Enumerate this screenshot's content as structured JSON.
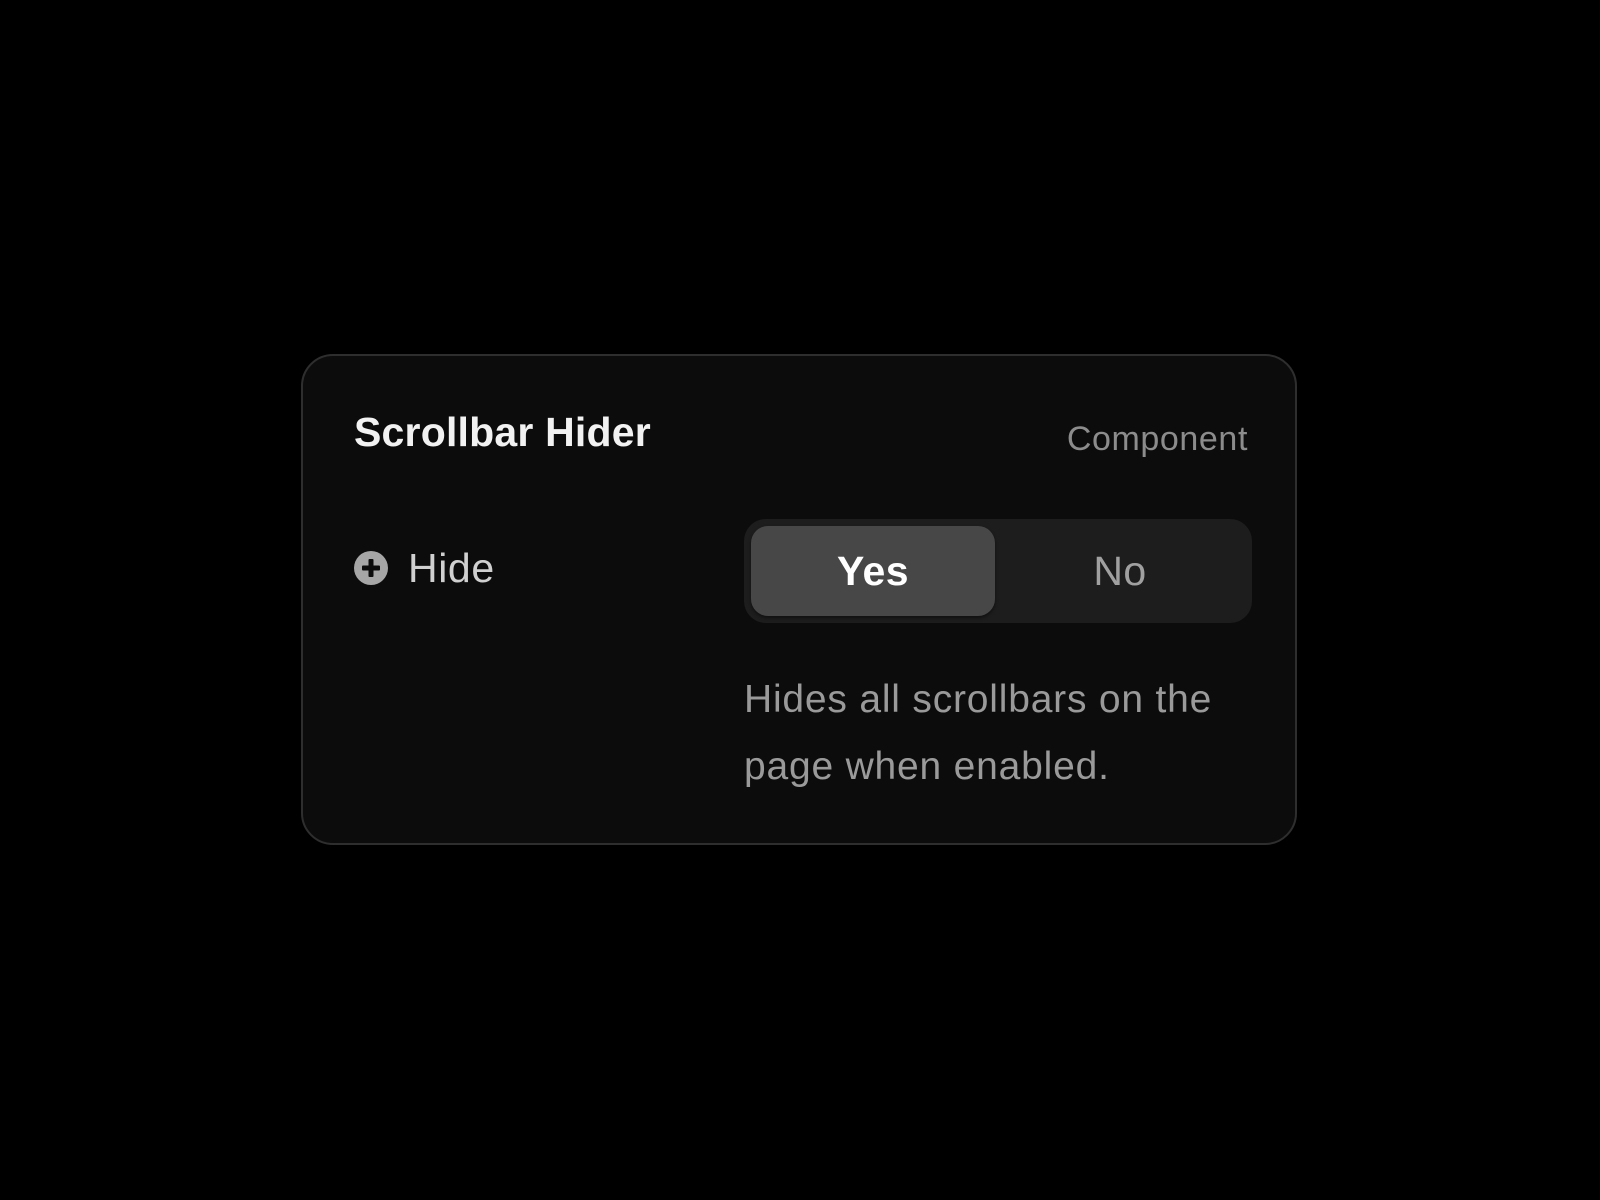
{
  "panel": {
    "title": "Scrollbar Hider",
    "type_label": "Component"
  },
  "property": {
    "icon": "plus-circle-icon",
    "label": "Hide",
    "options": [
      {
        "label": "Yes",
        "selected": true
      },
      {
        "label": "No",
        "selected": false
      }
    ],
    "description": "Hides all scrollbars on the page when enabled."
  },
  "colors": {
    "background": "#000000",
    "panel": "#0c0c0c",
    "panel_border": "#2e2e2e",
    "segment_track": "#1d1d1d",
    "segment_active": "#474747"
  }
}
